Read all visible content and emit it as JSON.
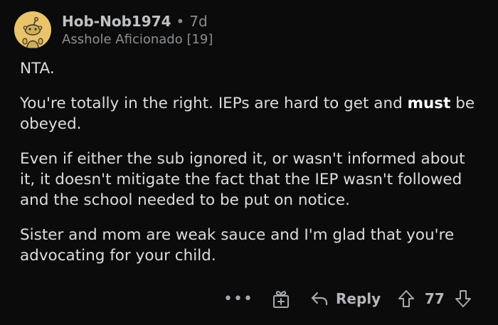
{
  "comment": {
    "author": "Hob-Nob1974",
    "separator": "•",
    "age": "7d",
    "flair": "Asshole Aficionado [19]",
    "paragraphs": {
      "p1": "NTA.",
      "p2_start": "You're totally in the right. IEPs are hard to get and ",
      "p2_bold": "must",
      "p2_end": " be obeyed.",
      "p3": "Even if either the sub ignored it, or wasn't informed about it, it doesn't mitigate the fact that the IEP wasn't followed and the school needed to be put on notice.",
      "p4": "Sister and mom are weak sauce and I'm glad that you're advocating for your child."
    }
  },
  "actions": {
    "more": "•••",
    "reply_label": "Reply",
    "score": "77"
  },
  "icons": {
    "avatar": "snoo-avatar-icon",
    "more": "more-options-icon",
    "award": "gift-award-icon",
    "reply": "reply-arrow-icon",
    "upvote": "upvote-arrow-icon",
    "downvote": "downvote-arrow-icon"
  },
  "colors": {
    "background": "#0b0b0b",
    "text": "#dcdde0",
    "muted": "#8a8f93",
    "avatar_bg": "#e9c46a"
  }
}
